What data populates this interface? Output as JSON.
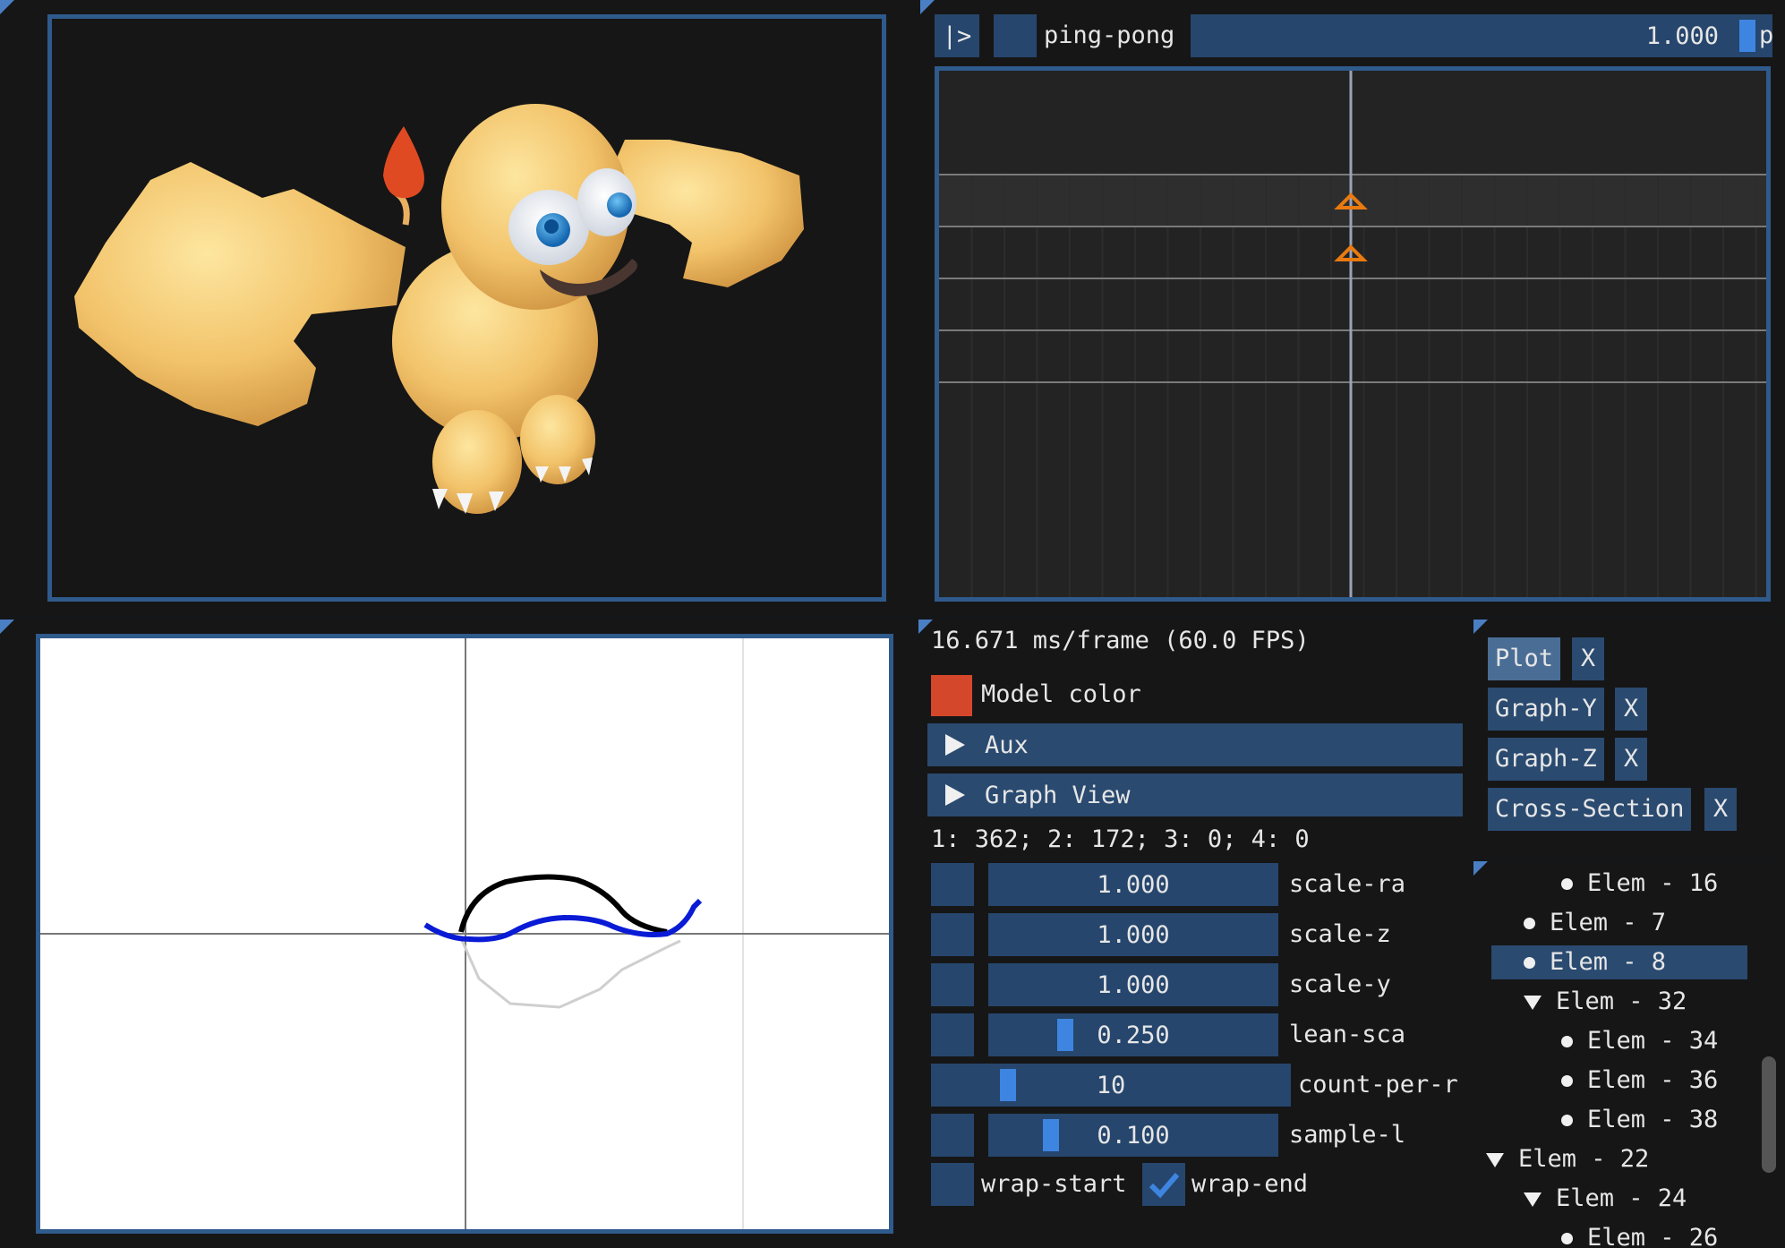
{
  "timeline": {
    "play_label": "|>",
    "mode": "ping-pong",
    "value": "1.000",
    "value_fraction": 0.97,
    "trailing_label": "p"
  },
  "stats": {
    "frame_time": "16.671 ms/frame (60.0 FPS)",
    "model_color_label": "Model color",
    "model_color": "#d4472a",
    "aux_header": "Aux",
    "graph_view_header": "Graph View",
    "counts": "1: 362; 2: 172; 3: 0; 4: 0"
  },
  "params": [
    {
      "label": "scale-ra",
      "value": "1.000",
      "fraction": null
    },
    {
      "label": "scale-z",
      "value": "1.000",
      "fraction": null
    },
    {
      "label": "scale-y",
      "value": "1.000",
      "fraction": null
    },
    {
      "label": "lean-sca",
      "value": "0.250",
      "fraction": 0.25
    },
    {
      "label": "count-per-r",
      "value": "10",
      "fraction": 0.2
    },
    {
      "label": "sample-l",
      "value": "0.100",
      "fraction": 0.2
    }
  ],
  "wrap": {
    "start_label": "wrap-start",
    "end_label": "wrap-end",
    "start_checked": false,
    "end_checked": true
  },
  "tabs": [
    {
      "label": "Plot",
      "close": "X",
      "active": true
    },
    {
      "label": "Graph-Y",
      "close": "X",
      "active": false
    },
    {
      "label": "Graph-Z",
      "close": "X",
      "active": false
    },
    {
      "label": "Cross-Section",
      "close": "X",
      "active": false
    }
  ],
  "tree": [
    {
      "label": "Elem - 16",
      "kind": "leaf",
      "selected": false
    },
    {
      "label": "Elem - 7",
      "kind": "leaf",
      "selected": false
    },
    {
      "label": "Elem - 8",
      "kind": "leaf",
      "selected": true
    },
    {
      "label": "Elem - 32",
      "kind": "open",
      "selected": false
    },
    {
      "label": "Elem - 34",
      "kind": "leaf",
      "selected": false
    },
    {
      "label": "Elem - 36",
      "kind": "leaf",
      "selected": false
    },
    {
      "label": "Elem - 38",
      "kind": "leaf",
      "selected": false
    },
    {
      "label": "Elem - 22",
      "kind": "open",
      "selected": false
    },
    {
      "label": "Elem - 24",
      "kind": "open",
      "selected": false
    },
    {
      "label": "Elem - 26",
      "kind": "leaf",
      "selected": false
    }
  ],
  "colors": {
    "accent": "#3d85e0",
    "frame": "#2f5a8c",
    "keyframe": "#e87a10",
    "curve_black": "#000000",
    "curve_blue": "#0a1bd6"
  }
}
